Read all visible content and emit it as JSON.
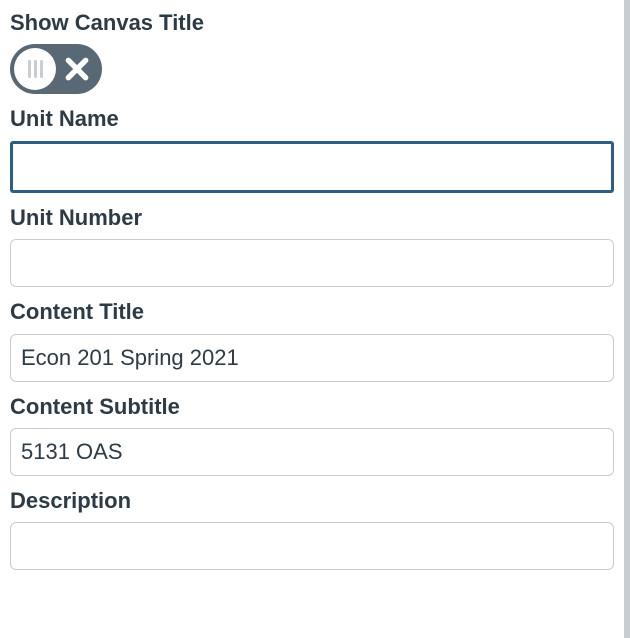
{
  "fields": {
    "show_canvas_title": {
      "label": "Show Canvas Title",
      "value": false
    },
    "unit_name": {
      "label": "Unit Name",
      "value": ""
    },
    "unit_number": {
      "label": "Unit Number",
      "value": ""
    },
    "content_title": {
      "label": "Content Title",
      "value": "Econ 201 Spring 2021"
    },
    "content_subtitle": {
      "label": "Content Subtitle",
      "value": "5131 OAS"
    },
    "description": {
      "label": "Description",
      "value": ""
    }
  }
}
